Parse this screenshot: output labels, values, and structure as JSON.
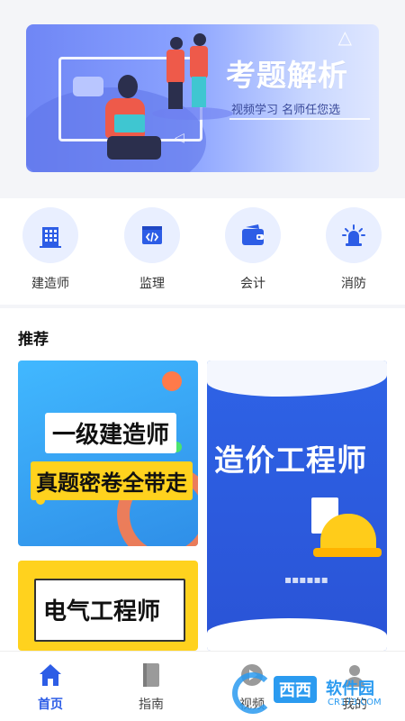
{
  "banner": {
    "title": "考题解析",
    "subtitle": "视频学习 名师任您选"
  },
  "categories": [
    {
      "label": "建造师",
      "icon": "building-icon"
    },
    {
      "label": "监理",
      "icon": "code-window-icon"
    },
    {
      "label": "会计",
      "icon": "wallet-icon"
    },
    {
      "label": "消防",
      "icon": "alarm-light-icon"
    }
  ],
  "recommend": {
    "heading": "推荐",
    "cards": [
      {
        "line1": "一级建造师",
        "line2": "真题密卷全带走"
      },
      {
        "title": "造价工程师"
      },
      {
        "title": "电气工程师"
      }
    ]
  },
  "nav": {
    "items": [
      {
        "label": "首页",
        "icon": "home-icon"
      },
      {
        "label": "指南",
        "icon": "book-icon"
      },
      {
        "label": "视频",
        "icon": "play-icon"
      },
      {
        "label": "我的",
        "icon": "user-icon"
      }
    ]
  },
  "watermark": {
    "brand": "西西",
    "name": "软件园",
    "site": "CR173.COM"
  },
  "colors": {
    "accent": "#2d5de6",
    "icon_bg": "#e9efff",
    "page_bg": "#f4f5f8"
  }
}
